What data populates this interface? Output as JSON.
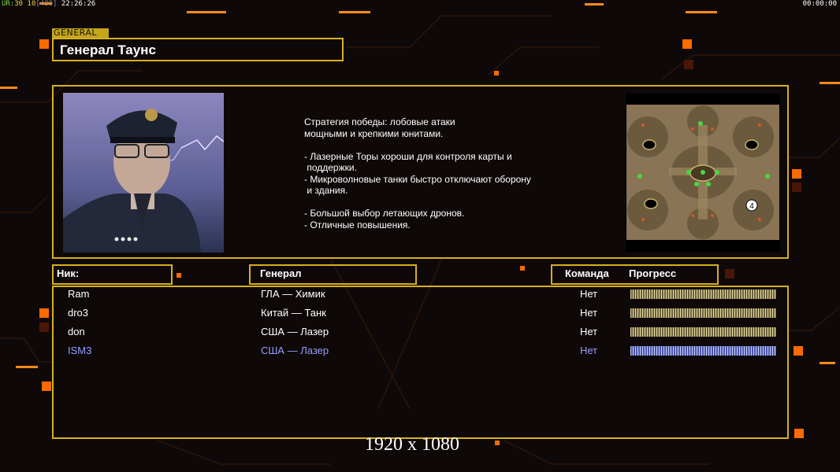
{
  "hud": {
    "left_ur": "UR:",
    "left_nums": "30 10",
    "left_bracket": "[480]",
    "left_time": "22:26:26",
    "right_time": "00:00:00"
  },
  "general_tag": "GENERAL",
  "general_name": "Генерал Таунс",
  "description": [
    "Стратегия победы: лобовые атаки",
    "мощными и крепкими юнитами.",
    "",
    "- Лазерные Торы хороши для контроля карты и",
    " поддержки.",
    "- Микроволновые танки быстро отключают оборону",
    " и здания.",
    "",
    "- Большой выбор летающих дронов.",
    "- Отличные повышения."
  ],
  "minimap_marker": "4",
  "headers": {
    "nick": "Ник:",
    "general": "Генерал",
    "team": "Команда",
    "progress": "Прогресс"
  },
  "players": [
    {
      "nick": "Ram",
      "general": "ГЛА — Химик",
      "team": "Нет",
      "progress": 1.0,
      "color": "#ffffff"
    },
    {
      "nick": "dro3",
      "general": "Китай — Танк",
      "team": "Нет",
      "progress": 1.0,
      "color": "#ffffff"
    },
    {
      "nick": "don",
      "general": "США — Лазер",
      "team": "Нет",
      "progress": 1.0,
      "color": "#ffffff"
    },
    {
      "nick": "ISM3",
      "general": "США — Лазер",
      "team": "Нет",
      "progress": 1.0,
      "color": "#9a9cff"
    }
  ],
  "resolution": "1920 x 1080",
  "colors": {
    "accent": "#d7b01c",
    "orange": "#ff6a00",
    "background": "#0e0908"
  }
}
